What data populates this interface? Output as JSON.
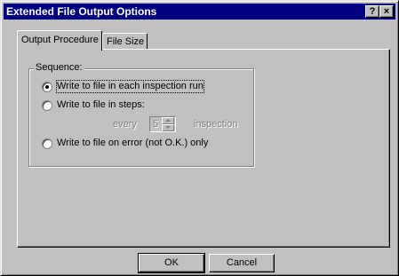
{
  "window": {
    "title": "Extended File Output Options",
    "help_button": "?",
    "close_button": "×"
  },
  "tabs": [
    {
      "label": "Output Procedure",
      "selected": true
    },
    {
      "label": "File Size",
      "selected": false
    }
  ],
  "sequence": {
    "label": "Sequence:",
    "options": [
      {
        "label": "Write to file in each inspection run",
        "selected": true
      },
      {
        "label": "Write to file in steps:",
        "selected": false
      },
      {
        "label": "Write to file on error (not O.K.) only",
        "selected": false
      }
    ],
    "steps": {
      "prefix": "every",
      "value": "5",
      "suffix": "inspection"
    }
  },
  "buttons": {
    "ok": "OK",
    "cancel": "Cancel"
  },
  "colors": {
    "titlebar": "#000080",
    "face": "#c0c0c0",
    "disabled_text": "#808080"
  }
}
